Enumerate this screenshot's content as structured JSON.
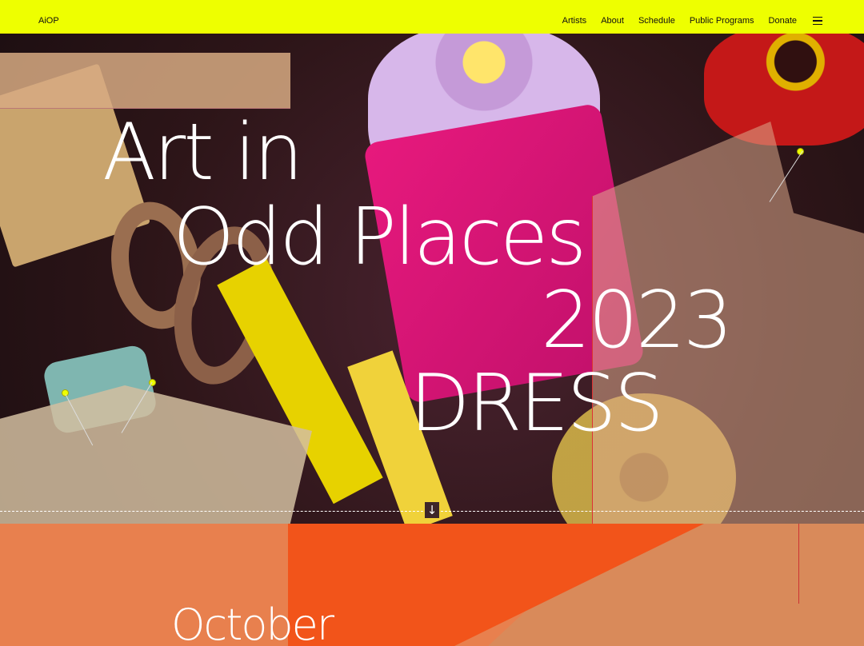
{
  "header": {
    "logo": "AiOP",
    "nav": [
      {
        "label": "Artists"
      },
      {
        "label": "About"
      },
      {
        "label": "Schedule"
      },
      {
        "label": "Public Programs"
      },
      {
        "label": "Donate"
      }
    ],
    "menu_icon": "hamburger-menu-icon",
    "background_color": "#eeff00"
  },
  "hero": {
    "title_lines": [
      "Art in",
      "Odd Places",
      "2023",
      "DRESS"
    ],
    "scroll_icon": "arrow-down-icon",
    "scroll_glyph": "↓"
  },
  "lower": {
    "heading": "October"
  },
  "colors": {
    "accent_yellow": "#eeff00",
    "orange": "#f2541a",
    "tan_orange": "#e8804e"
  }
}
